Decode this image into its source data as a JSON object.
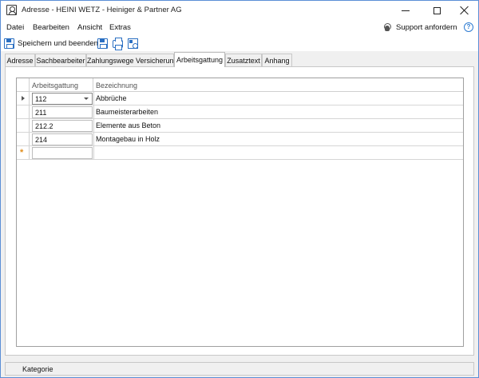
{
  "window": {
    "title": "Adresse - HEINI WETZ - Heiniger & Partner AG"
  },
  "menu": {
    "items": [
      "Datei",
      "Bearbeiten",
      "Ansicht",
      "Extras"
    ],
    "support_label": "Support anfordern",
    "help_icon": "?"
  },
  "toolbar": {
    "save_close_label": "Speichern und beenden",
    "icons": [
      "save-close-icon",
      "save-icon",
      "print-icon",
      "settings-icon"
    ]
  },
  "tabs": {
    "items": [
      "Adresse",
      "Sachbearbeiter",
      "Zahlungswege Versicherung",
      "Arbeitsgattung",
      "Zusatztext",
      "Anhang"
    ],
    "active": "Arbeitsgattung"
  },
  "grid": {
    "columns": [
      "Arbeitsgattung",
      "Bezeichnung"
    ],
    "rows": [
      {
        "code": "112",
        "label": "Abbrüche"
      },
      {
        "code": "211",
        "label": "Baumeisterarbeiten"
      },
      {
        "code": "212.2",
        "label": "Elemente aus Beton"
      },
      {
        "code": "214",
        "label": "Montagebau in Holz"
      }
    ],
    "new_row_marker": "*"
  },
  "status": {
    "label": "Kategorie"
  },
  "colors": {
    "accent": "#2b6fc2",
    "new_row_marker": "#e08c1a",
    "window_border": "#5b8fd6"
  }
}
